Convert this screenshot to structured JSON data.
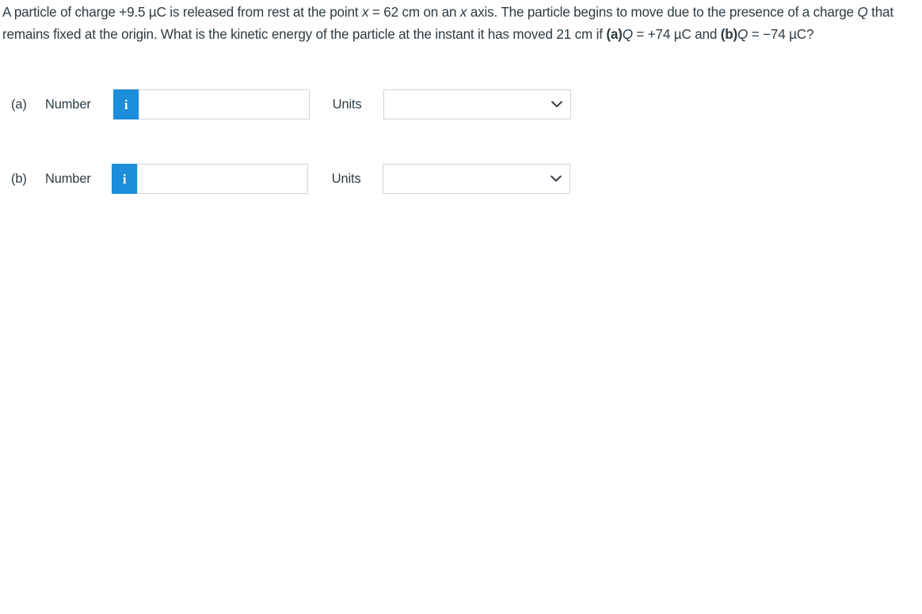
{
  "question": {
    "segments": [
      {
        "text": "A particle of charge +9.5 µC is released from rest at the point ",
        "style": "normal"
      },
      {
        "text": "x",
        "style": "italic"
      },
      {
        "text": " = 62 cm on an ",
        "style": "normal"
      },
      {
        "text": "x",
        "style": "italic"
      },
      {
        "text": " axis. The particle begins to move due to the presence of a charge ",
        "style": "normal"
      },
      {
        "text": "Q",
        "style": "italic"
      },
      {
        "text": " that remains fixed at the origin. What is the kinetic energy of the particle at the instant it has moved 21 cm if ",
        "style": "normal"
      },
      {
        "text": "(a)",
        "style": "bold"
      },
      {
        "text": "Q",
        "style": "italic"
      },
      {
        "text": " = +74 µC and ",
        "style": "normal"
      },
      {
        "text": "(b)",
        "style": "bold"
      },
      {
        "text": "Q",
        "style": "italic"
      },
      {
        "text": " = −74 µC?",
        "style": "normal"
      }
    ],
    "plain_text": "A particle of charge +9.5 µC is released from rest at the point x = 62 cm on an x axis. The particle begins to move due to the presence of a charge Q that remains fixed at the origin. What is the kinetic energy of the particle at the instant it has moved 21 cm if (a)Q = +74 µC and (b)Q = −74 µC?"
  },
  "answers": [
    {
      "part_label": "(a)",
      "number_label": "Number",
      "info_badge_glyph": "i",
      "info_badge_icon": "info-icon",
      "number_value": "",
      "number_placeholder": "",
      "units_label": "Units",
      "units_value": "",
      "units_options": [
        ""
      ],
      "chevron_icon": "chevron-down-icon"
    },
    {
      "part_label": "(b)",
      "number_label": "Number",
      "info_badge_glyph": "i",
      "info_badge_icon": "info-icon",
      "number_value": "",
      "number_placeholder": "",
      "units_label": "Units",
      "units_value": "",
      "units_options": [
        ""
      ],
      "chevron_icon": "chevron-down-icon"
    }
  ],
  "colors": {
    "info_badge_blue": "#1b8ddb",
    "text": "#2d3b45",
    "field_border": "#ced4da",
    "background": "#ffffff"
  }
}
